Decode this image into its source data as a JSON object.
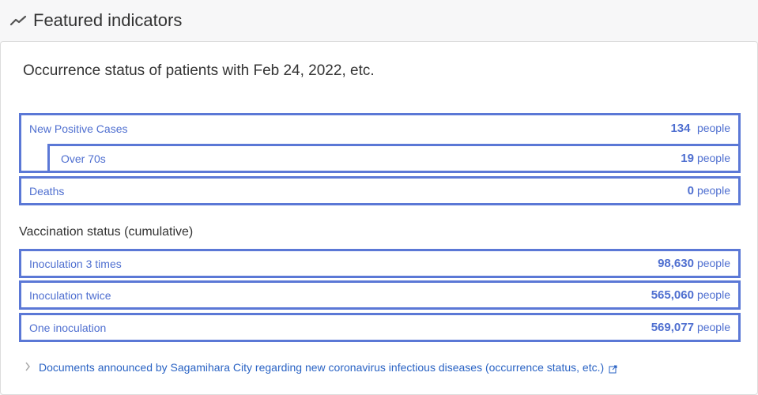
{
  "header": {
    "title": "Featured indicators"
  },
  "card": {
    "heading": "Occurrence status of patients with Feb 24, 2022, etc.",
    "new_positive": {
      "label": "New Positive Cases",
      "value": "134",
      "unit": "people"
    },
    "over70": {
      "label": "Over 70s",
      "value": "19",
      "unit": "people"
    },
    "deaths": {
      "label": "Deaths",
      "value": "0",
      "unit": "people"
    },
    "vaccination_heading": "Vaccination status (cumulative)",
    "vaccination": [
      {
        "label": "Inoculation 3 times",
        "value": "98,630",
        "unit": "people"
      },
      {
        "label": "Inoculation twice",
        "value": "565,060",
        "unit": "people"
      },
      {
        "label": "One inoculation",
        "value": "569,077",
        "unit": "people"
      }
    ],
    "doc_link": "Documents announced by Sagamihara City regarding new coronavirus infectious diseases (occurrence status, etc.)"
  },
  "colors": {
    "accent": "#5b78d6",
    "link": "#2a63c4"
  }
}
